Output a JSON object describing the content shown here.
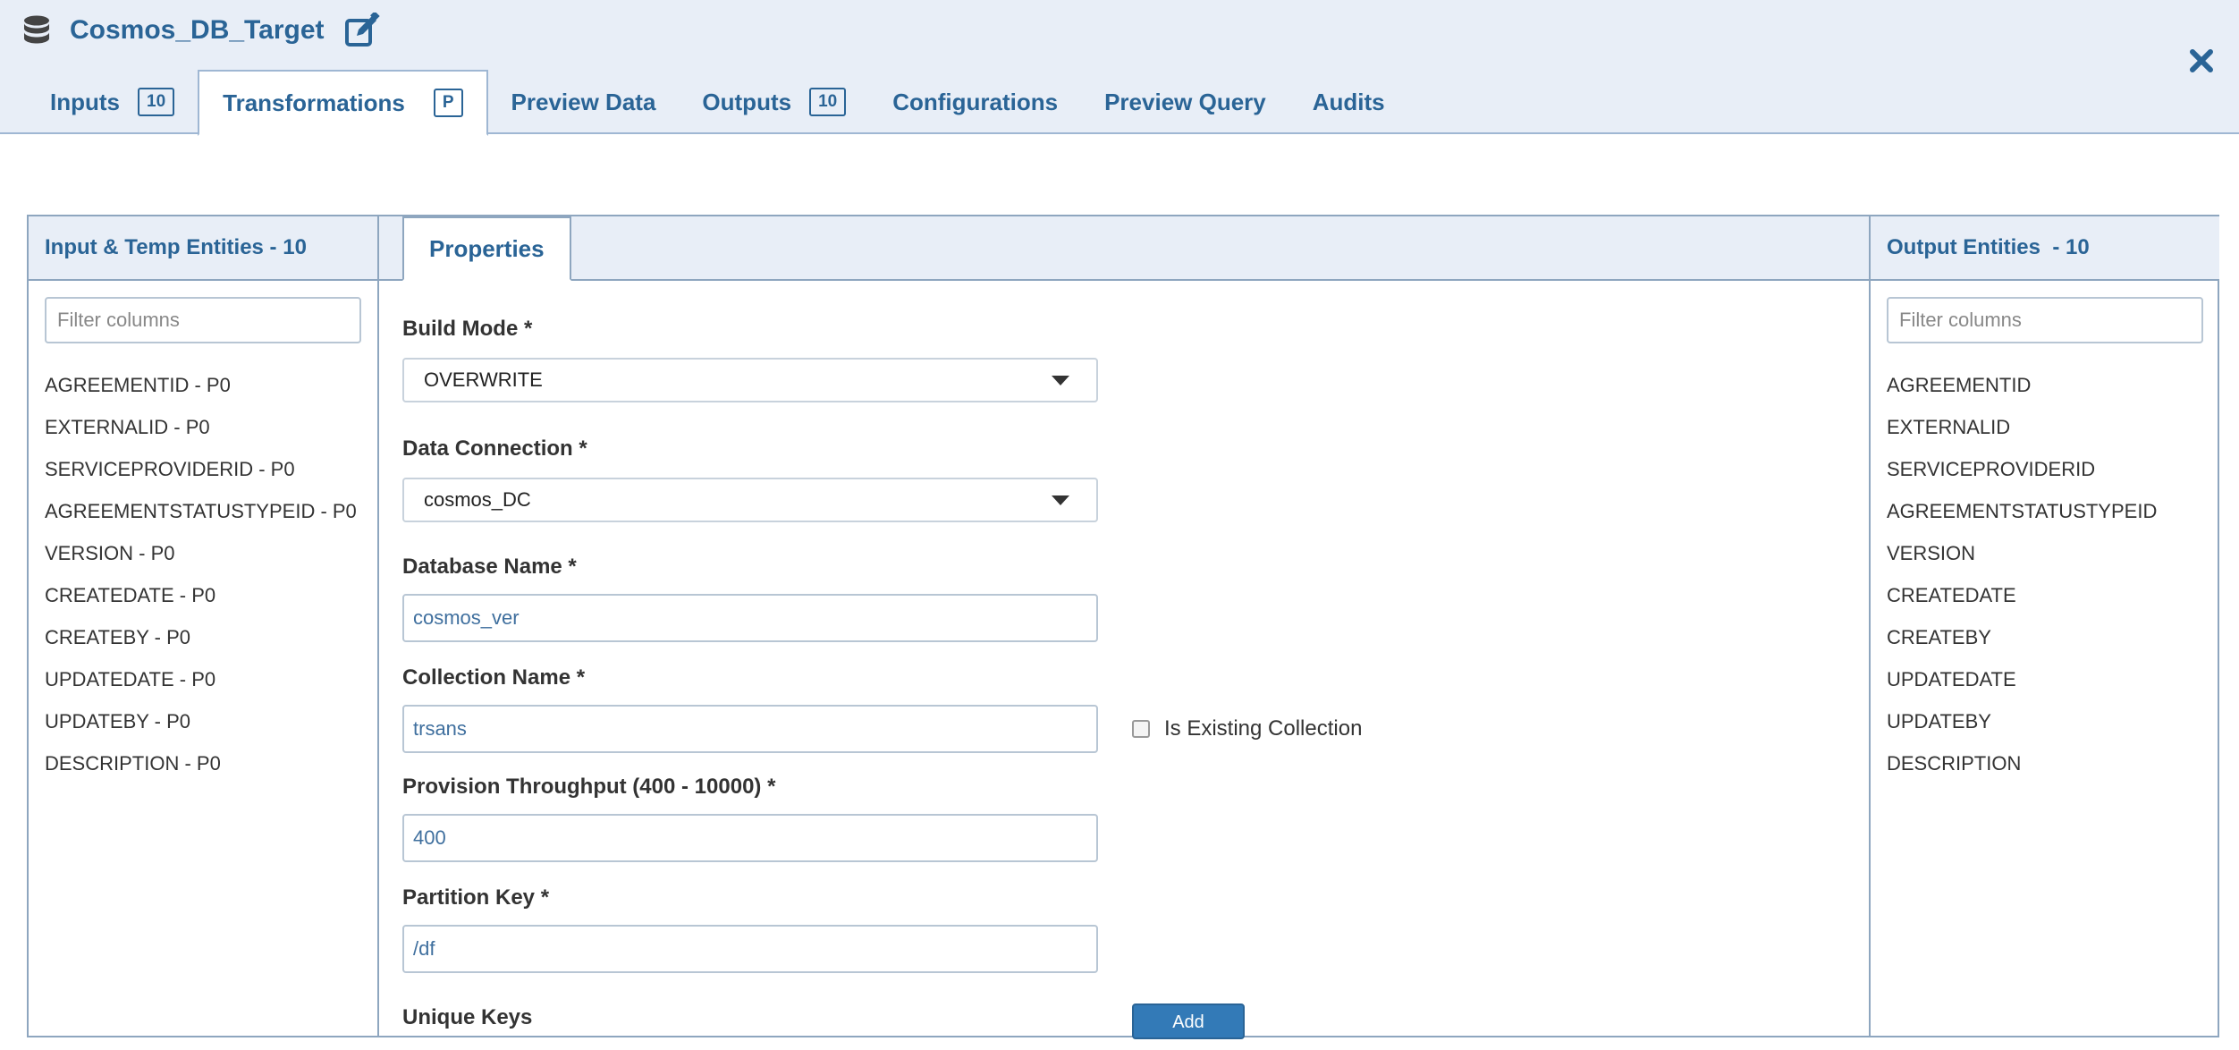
{
  "header": {
    "title": "Cosmos_DB_Target",
    "tabs": [
      {
        "label": "Inputs",
        "badge": "10"
      },
      {
        "label": "Transformations",
        "badge": "P"
      },
      {
        "label": "Preview Data"
      },
      {
        "label": "Outputs",
        "badge": "10"
      },
      {
        "label": "Configurations"
      },
      {
        "label": "Preview Query"
      },
      {
        "label": "Audits"
      }
    ]
  },
  "left_panel": {
    "title": "Input & Temp Entities - 10",
    "filter_placeholder": "Filter columns",
    "items": [
      "AGREEMENTID - P0",
      "EXTERNALID - P0",
      "SERVICEPROVIDERID - P0",
      "AGREEMENTSTATUSTYPEID - P0",
      "VERSION - P0",
      "CREATEDATE - P0",
      "CREATEBY - P0",
      "UPDATEDATE - P0",
      "UPDATEBY - P0",
      "DESCRIPTION - P0"
    ]
  },
  "middle_panel": {
    "tab": "Properties",
    "build_mode": {
      "label": "Build Mode *",
      "value": "OVERWRITE"
    },
    "data_connection": {
      "label": "Data Connection *",
      "value": "cosmos_DC"
    },
    "database_name": {
      "label": "Database Name *",
      "value": "cosmos_ver"
    },
    "collection_name": {
      "label": "Collection Name *",
      "value": "trsans"
    },
    "is_existing_collection": {
      "label": "Is Existing Collection",
      "checked": false
    },
    "provision_throughput": {
      "label": "Provision Throughput (400 - 10000) *",
      "value": "400"
    },
    "partition_key": {
      "label": "Partition Key *",
      "value": "/df"
    },
    "unique_keys": {
      "label": "Unique Keys",
      "add_button": "Add"
    }
  },
  "right_panel": {
    "title": "Output Entities  - 10",
    "filter_placeholder": "Filter columns",
    "items": [
      "AGREEMENTID",
      "EXTERNALID",
      "SERVICEPROVIDERID",
      "AGREEMENTSTATUSTYPEID",
      "VERSION",
      "CREATEDATE",
      "CREATEBY",
      "UPDATEDATE",
      "UPDATEBY",
      "DESCRIPTION"
    ]
  },
  "colors": {
    "accent": "#2a6496",
    "header_bg": "#e8eef7",
    "button": "#337ab7"
  }
}
